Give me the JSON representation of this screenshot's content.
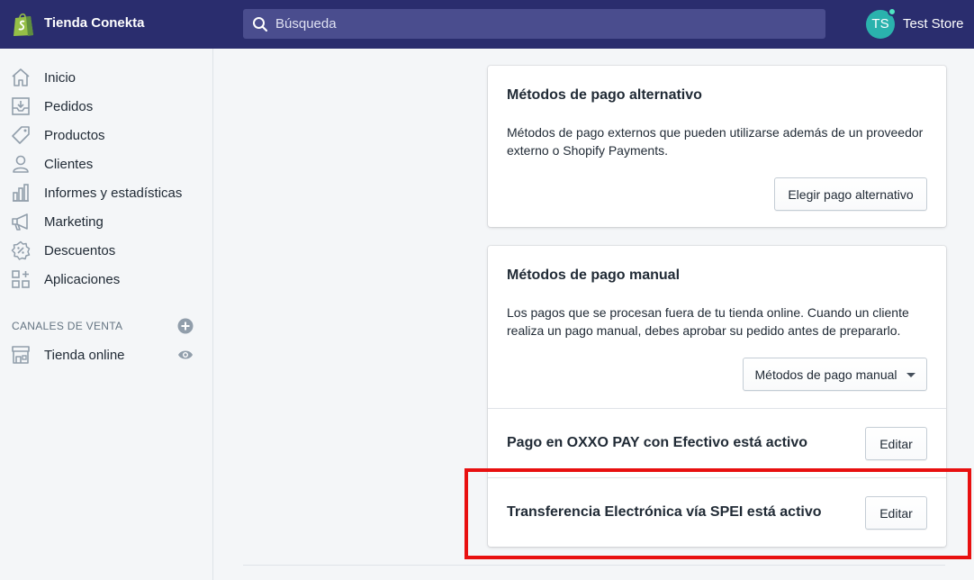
{
  "topbar": {
    "store_name": "Tienda Conekta",
    "search_placeholder": "Búsqueda",
    "avatar_initials": "TS",
    "user_name": "Test Store"
  },
  "sidebar": {
    "items": [
      {
        "label": "Inicio",
        "icon": "home-icon"
      },
      {
        "label": "Pedidos",
        "icon": "orders-icon"
      },
      {
        "label": "Productos",
        "icon": "tag-icon"
      },
      {
        "label": "Clientes",
        "icon": "customer-icon"
      },
      {
        "label": "Informes y estadísticas",
        "icon": "bar-chart-icon"
      },
      {
        "label": "Marketing",
        "icon": "megaphone-icon"
      },
      {
        "label": "Descuentos",
        "icon": "discount-icon"
      },
      {
        "label": "Aplicaciones",
        "icon": "apps-icon"
      }
    ],
    "channels_label": "CANALES DE VENTA",
    "channels": [
      {
        "label": "Tienda online",
        "icon": "store-icon"
      }
    ]
  },
  "main": {
    "alt_payments": {
      "title": "Métodos de pago alternativo",
      "description": "Métodos de pago externos que pueden utilizarse además de un proveedor externo o Shopify Payments.",
      "button": "Elegir pago alternativo"
    },
    "manual_payments": {
      "title": "Métodos de pago manual",
      "description": "Los pagos que se procesan fuera de tu tienda online. Cuando un cliente realiza un pago manual, debes aprobar su pedido antes de prepararlo.",
      "dropdown": "Métodos de pago manual",
      "methods": [
        {
          "label": "Pago en OXXO PAY con Efectivo está activo",
          "button": "Editar"
        },
        {
          "label": "Transferencia Electrónica vía SPEI está activo",
          "button": "Editar"
        }
      ]
    }
  },
  "colors": {
    "topbar": "#2a2d6e",
    "search": "#4a4d8e",
    "avatar": "#2ab2ad",
    "highlight": "#e81010"
  }
}
